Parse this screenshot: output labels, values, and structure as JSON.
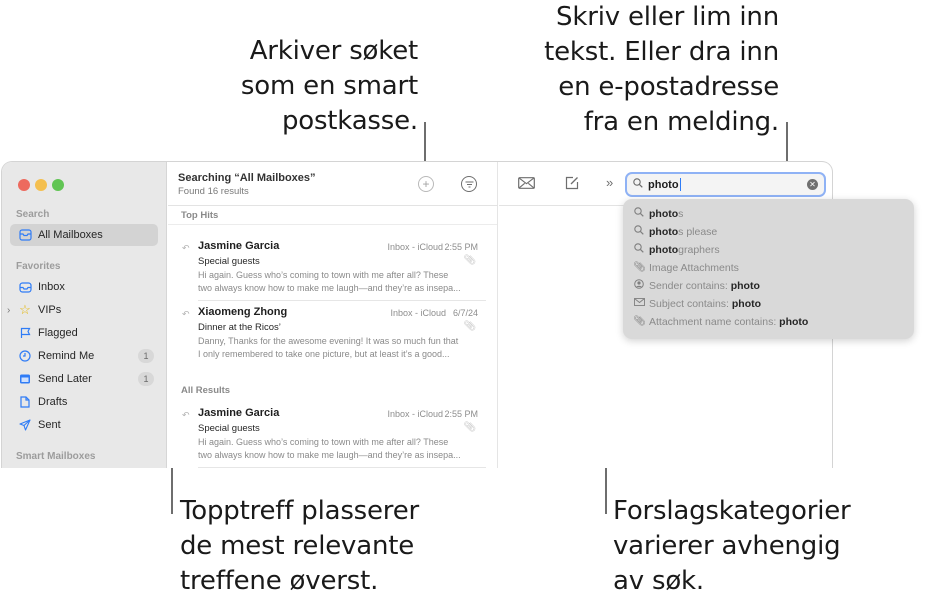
{
  "callouts": {
    "archive": "Arkiver søket\nsom en smart\npostkasse.",
    "search": "Skriv eller lim inn\ntekst. Eller dra inn\nen e-postadresse\nfra en melding.",
    "top_hits": "Topptreff plasserer\nde mest relevante\ntreffene øverst.",
    "categories": "Forslagskategorier\nvarierer avhengig\nav søk."
  },
  "sidebar": {
    "sections": {
      "search": "Search",
      "favorites": "Favorites",
      "smart": "Smart Mailboxes"
    },
    "search_item": {
      "label": "All Mailboxes",
      "icon": "tray-stack-icon",
      "selected": true
    },
    "items": [
      {
        "label": "Inbox",
        "icon": "inbox-icon"
      },
      {
        "label": "VIPs",
        "icon": "star-icon",
        "expandable": true
      },
      {
        "label": "Flagged",
        "icon": "flag-icon"
      },
      {
        "label": "Remind Me",
        "icon": "clock-icon",
        "badge": "1"
      },
      {
        "label": "Send Later",
        "icon": "calendar-icon",
        "badge": "1"
      },
      {
        "label": "Drafts",
        "icon": "document-icon"
      },
      {
        "label": "Sent",
        "icon": "paper-plane-icon"
      }
    ]
  },
  "list": {
    "title": "Searching “All Mailboxes”",
    "subtitle": "Found 16 results",
    "top_hits_label": "Top Hits",
    "all_results_label": "All Results",
    "top_hits": [
      {
        "from": "Jasmine Garcia",
        "mailbox": "Inbox - iCloud",
        "date": "2:55 PM",
        "subject": "Special guests",
        "preview": "Hi again. Guess who’s coming to town with me after all? These\ntwo always know how to make me laugh—and they’re as insepa..."
      },
      {
        "from": "Xiaomeng Zhong",
        "mailbox": "Inbox - iCloud",
        "date": "6/7/24",
        "subject": "Dinner at the Ricos’",
        "preview": "Danny, Thanks for the awesome evening! It was so much fun that\nI only remembered to take one picture, but at least it’s a good..."
      }
    ],
    "all_results": [
      {
        "from": "Jasmine Garcia",
        "mailbox": "Inbox - iCloud",
        "date": "2:55 PM",
        "subject": "Special guests",
        "preview": "Hi again. Guess who’s coming to town with me after all? These\ntwo always know how to make me laugh—and they’re as insepa..."
      }
    ]
  },
  "search": {
    "query": "photo"
  },
  "suggestions": [
    {
      "icon": "search-icon",
      "bold": "photo",
      "rest": "s",
      "order": "bold-first"
    },
    {
      "icon": "search-icon",
      "bold": "photo",
      "rest": "s please",
      "order": "bold-first"
    },
    {
      "icon": "search-icon",
      "bold": "photo",
      "rest": "graphers",
      "order": "bold-first"
    },
    {
      "icon": "paperclip-icon",
      "bold": "",
      "rest": "Image Attachments",
      "order": "plain"
    },
    {
      "icon": "person-circle-icon",
      "bold": "photo",
      "rest": "Sender contains: ",
      "order": "plain-first"
    },
    {
      "icon": "envelope-icon",
      "bold": "photo",
      "rest": "Subject contains: ",
      "order": "plain-first"
    },
    {
      "icon": "paperclip-icon",
      "bold": "photo",
      "rest": "Attachment name contains: ",
      "order": "plain-first"
    }
  ]
}
